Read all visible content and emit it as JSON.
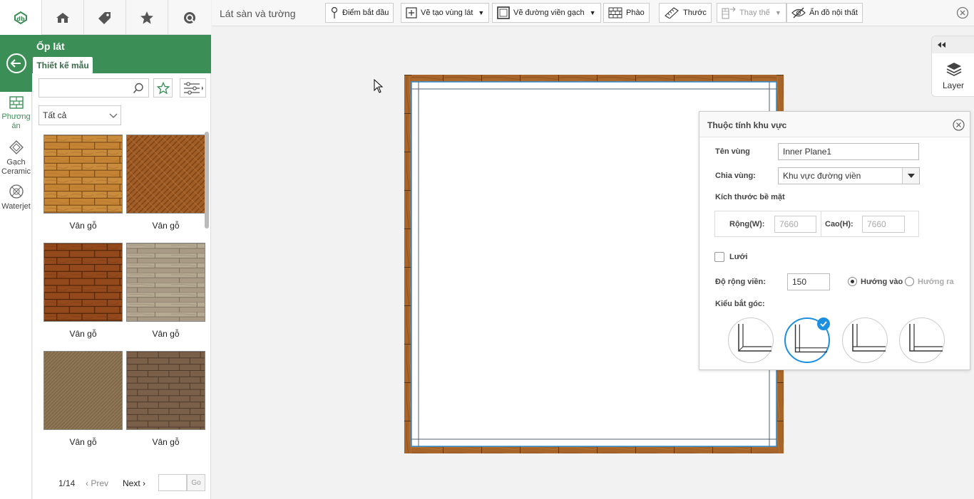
{
  "colors": {
    "brand_green": "#3b8f56",
    "accent_blue": "#1b8fe0",
    "wood_border": "#a8652a"
  },
  "top_tabs": [
    {
      "icon": "brand-logo-icon"
    },
    {
      "icon": "house-icon"
    },
    {
      "icon": "tag-icon"
    },
    {
      "icon": "star-icon"
    },
    {
      "icon": "chat-icon"
    }
  ],
  "panel": {
    "title": "Ốp lát",
    "subtab": "Thiết kế mẫu",
    "search_placeholder": "",
    "category_selected": "Tất cả"
  },
  "rail": [
    {
      "label_line1": "Phương",
      "label_line2": "án",
      "icon": "plan-grid-icon"
    },
    {
      "label_line1": "Gạch",
      "label_line2": "Ceramic",
      "icon": "ceramic-tile-icon"
    },
    {
      "label_line1": "Waterjet",
      "label_line2": "",
      "icon": "waterjet-icon"
    }
  ],
  "tiles": [
    {
      "caption": "Vân gỗ",
      "pattern": "brick-wood-light"
    },
    {
      "caption": "Vân gỗ",
      "pattern": "herringbone-wood"
    },
    {
      "caption": "Vân gỗ",
      "pattern": "brick-wood-dark"
    },
    {
      "caption": "Vân gỗ",
      "pattern": "plank-grey"
    },
    {
      "caption": "Vân gỗ",
      "pattern": "herringbone-taupe"
    },
    {
      "caption": "Vân gỗ",
      "pattern": "brick-wood-brown"
    }
  ],
  "pager": {
    "count": "1/14",
    "prev": "Prev",
    "next": "Next",
    "page_value": "",
    "go": "Go"
  },
  "toolbar": {
    "title": "Lát sàn và tường",
    "buttons": [
      {
        "label": "Điểm bắt đầu",
        "icon": "pin-icon"
      },
      {
        "label": "Vẽ tạo vùng lát",
        "icon": "add-area-icon"
      },
      {
        "label": "Vẽ đường viền gạch",
        "icon": "border-icon"
      },
      {
        "label": "Phào",
        "icon": "molding-icon"
      },
      {
        "label": "Thước",
        "icon": "ruler-icon"
      },
      {
        "label": "Thay thế",
        "icon": "replace-icon"
      },
      {
        "label": "Ẩn đồ nội thất",
        "icon": "hide-furniture-icon"
      }
    ]
  },
  "layer": {
    "label": "Layer"
  },
  "props": {
    "title": "Thuộc tính khu vực",
    "name_label": "Tên vùng",
    "name_value": "Inner Plane1",
    "split_label": "Chia vùng:",
    "split_value": "Khu vực đường viền",
    "size_label": "Kích thước bề mặt",
    "width_label": "Rộng(W):",
    "width_value": "7660",
    "height_label": "Cao(H):",
    "height_value": "7660",
    "grid_label": "Lưới",
    "border_label": "Độ rộng viền:",
    "border_value": "150",
    "dir_in": "Hướng vào",
    "dir_out": "Hướng ra",
    "corner_label": "Kiểu bắt góc:"
  }
}
